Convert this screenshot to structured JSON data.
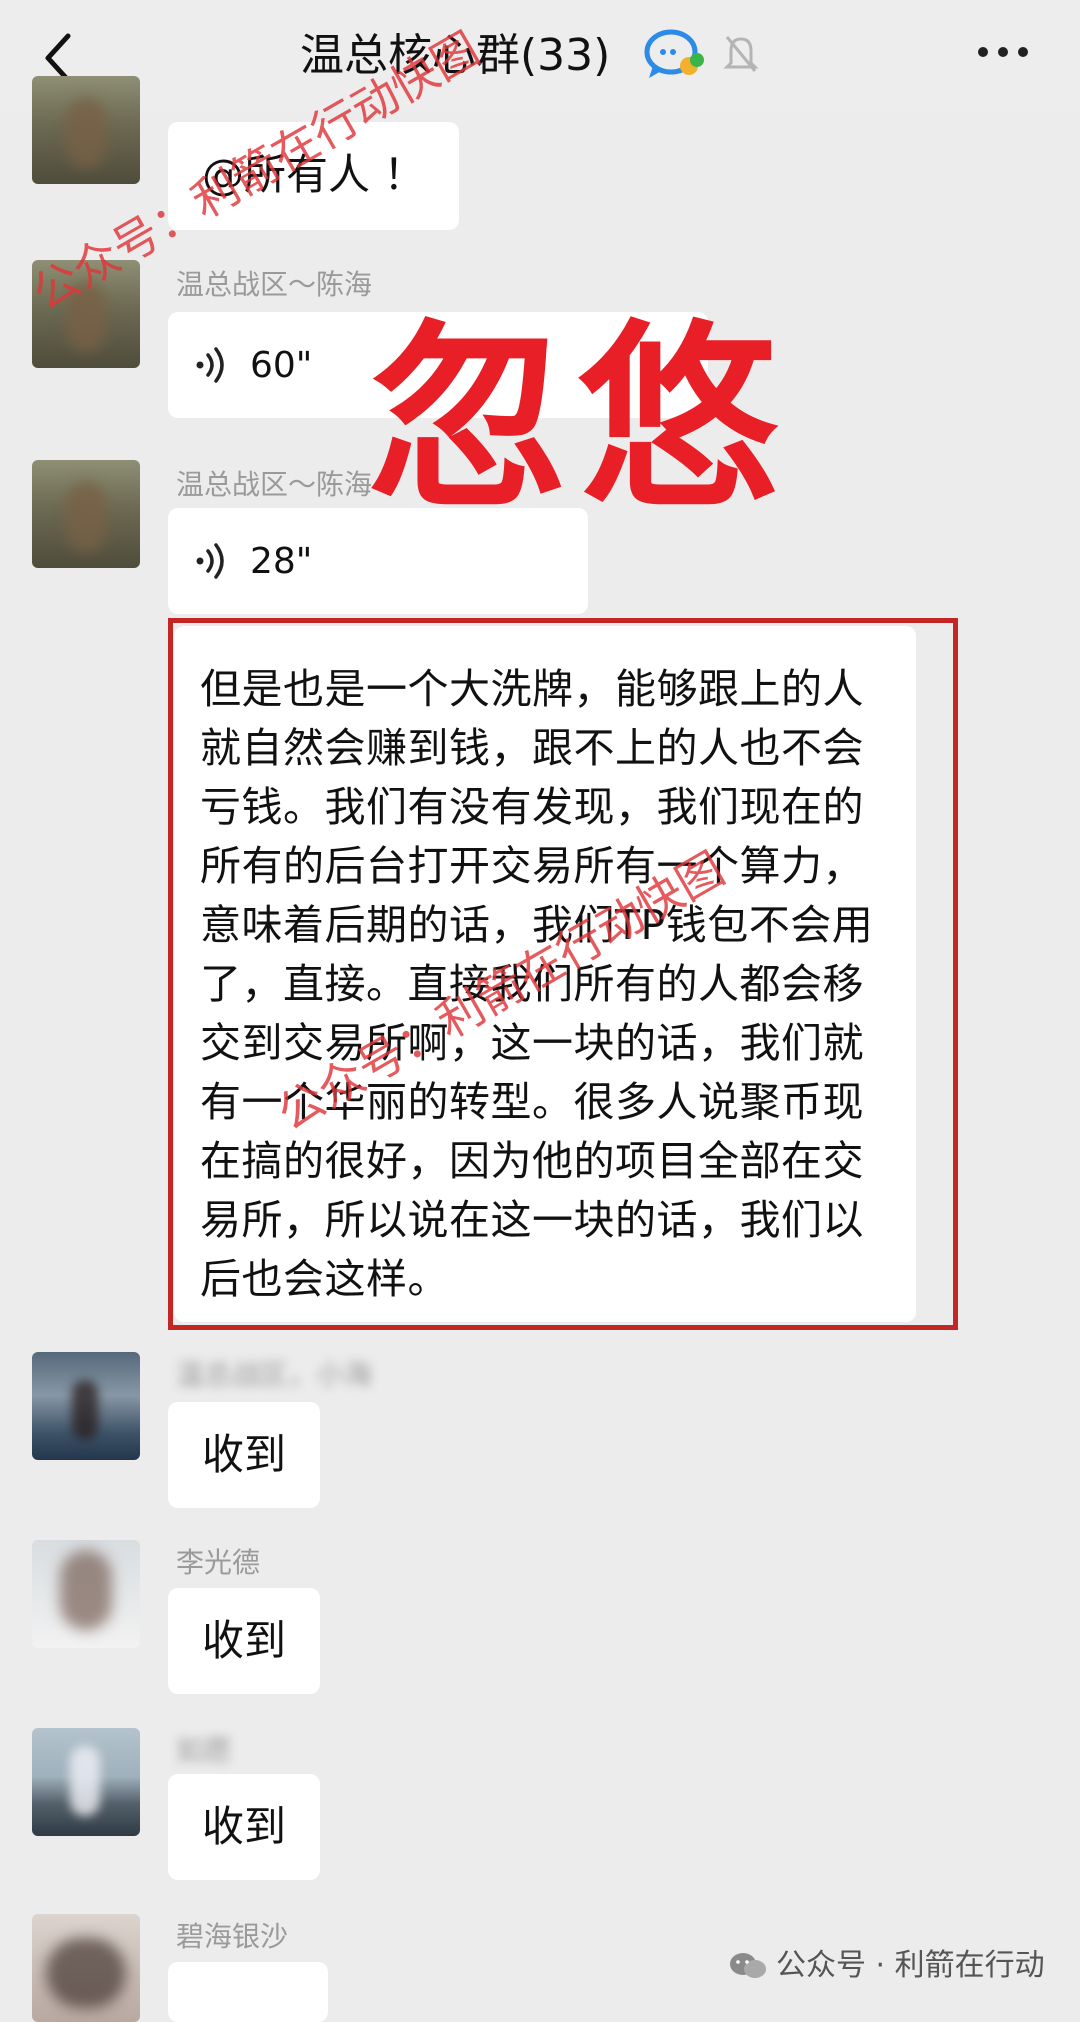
{
  "header": {
    "back_icon": "chevron-left-icon",
    "title": "温总核心群(33)",
    "chat_icon": "group-chat-icon",
    "bell_icon": "mute-bell-icon",
    "more_icon": "more-dots-icon"
  },
  "messages": [
    {
      "sender": "",
      "type": "text",
      "text": "@所有人 ！"
    },
    {
      "sender": "温总战区～陈海",
      "type": "voice",
      "duration": "60\""
    },
    {
      "sender": "温总战区～陈海",
      "type": "voice",
      "duration": "28\""
    },
    {
      "sender": "",
      "type": "text",
      "text": "但是也是一个大洗牌，能够跟上的人就自然会赚到钱，跟不上的人也不会亏钱。我们有没有发现，我们现在的所有的后台打开交易所有一个算力，意味着后期的话，我们TP钱包不会用了，直接。直接我们所有的人都会移交到交易所啊，这一块的话，我们就有一个华丽的转型。很多人说聚币现在搞的很好，因为他的项目全部在交易所，所以说在这一块的话，我们以后也会这样。"
    },
    {
      "sender": "温总战区，小海",
      "type": "text",
      "text": "收到"
    },
    {
      "sender": "李光德",
      "type": "text",
      "text": "收到"
    },
    {
      "sender": "如愿",
      "type": "text",
      "text": "收到"
    },
    {
      "sender": "碧海银沙",
      "type": "text",
      "text": ""
    }
  ],
  "overlay": {
    "stamp": "忽悠",
    "watermark": "公众号：利箭在行动快图",
    "footer": "公众号 · 利箭在行动"
  },
  "colors": {
    "stamp_red": "#e81f26",
    "frame_red": "#c32725",
    "background": "#ececec"
  }
}
